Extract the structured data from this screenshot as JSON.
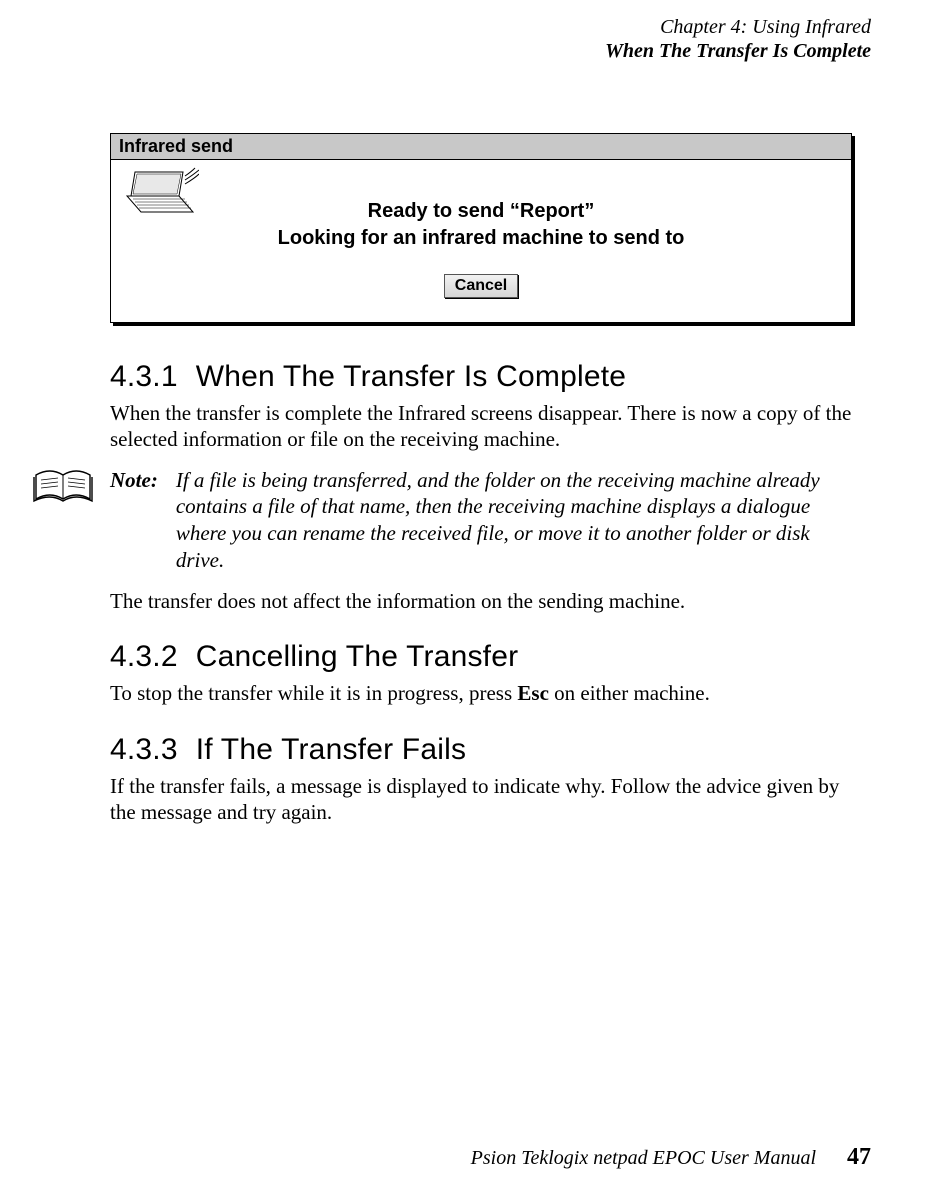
{
  "header": {
    "chapter": "Chapter 4:  Using Infrared",
    "section": "When The Transfer Is Complete"
  },
  "dialog": {
    "title": "Infrared send",
    "line1": "Ready to send “Report”",
    "line2": "Looking for an infrared machine to send to",
    "cancel_label": "Cancel"
  },
  "s1": {
    "num": "4.3.1",
    "title": "When The Transfer Is Complete",
    "p1": "When the transfer is complete the Infrared screens disappear. There is now a copy of the selected information or file on the receiving machine.",
    "note_label": "Note:",
    "note_text": "If a file is being transferred, and the folder on the receiving machine already contains a file of that name, then the receiving machine displays a dialogue where you can rename the received file, or move it to another folder or disk drive.",
    "p2": "The transfer does not affect the information on the sending machine."
  },
  "s2": {
    "num": "4.3.2",
    "title": "Cancelling The Transfer",
    "p1_a": "To stop the transfer while it is in progress, press ",
    "p1_key": "Esc",
    "p1_b": " on either machine."
  },
  "s3": {
    "num": "4.3.3",
    "title": "If The Transfer Fails",
    "p1": "If the transfer fails, a message is displayed to indicate why. Follow the advice given by the message and try again."
  },
  "footer": {
    "manual": "Psion Teklogix netpad EPOC User Manual",
    "page": "47"
  }
}
